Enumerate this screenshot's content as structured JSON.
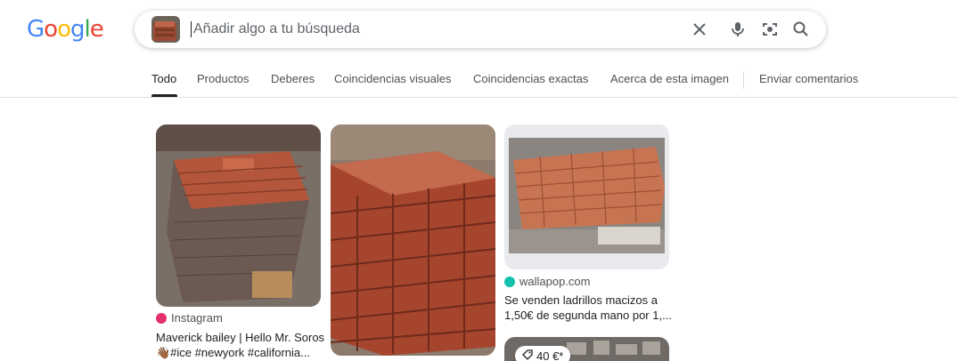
{
  "logo": {
    "letters": [
      "G",
      "o",
      "o",
      "g",
      "l",
      "e"
    ],
    "colors": [
      "#4285F4",
      "#EA4335",
      "#FBBC05",
      "#4285F4",
      "#34A853",
      "#EA4335"
    ]
  },
  "search": {
    "placeholder": "Añadir algo a tu búsqueda",
    "value": ""
  },
  "tabs": [
    {
      "label": "Todo",
      "active": true
    },
    {
      "label": "Productos"
    },
    {
      "label": "Deberes"
    },
    {
      "label": "Coincidencias visuales"
    },
    {
      "label": "Coincidencias exactas"
    },
    {
      "label": "Acerca de esta imagen"
    },
    {
      "label": "Enviar comentarios"
    }
  ],
  "results": [
    {
      "source": "Instagram",
      "title_line1": "Maverick bailey | Hello Mr. Soros",
      "title_line2": "👋🏾#ice #newyork #california..."
    },
    {
      "source": ""
    },
    {
      "source": "wallapop.com",
      "title_line1": "Se venden ladrillos macizos a",
      "title_line2": "1,50€ de segunda mano por 1,..."
    },
    {
      "price": "40 €*"
    }
  ],
  "colors": {
    "brick": "#b5563a",
    "brick_dark": "#8a3c28",
    "mortar": "#c9b8a8",
    "instagram": "#e1306c",
    "wallapop": "#13c1ac"
  }
}
